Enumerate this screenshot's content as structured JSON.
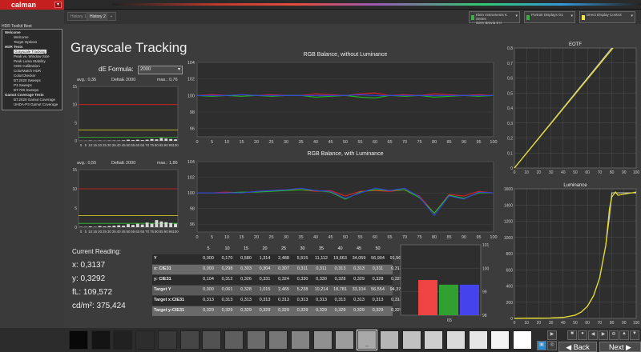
{
  "app": {
    "logo": "calman"
  },
  "tabs": [
    "History 1",
    "History 2"
  ],
  "devices": [
    {
      "line1": "Klein Instruments K Series",
      "line2": "Sony Bravia 8 II",
      "color": "#3cb043"
    },
    {
      "line1": "Portrait Displays G1",
      "line2": "",
      "color": "#3cb043"
    },
    {
      "line1": "Direct Display Control",
      "line2": "",
      "color": "#f1e34a"
    }
  ],
  "sidebar": {
    "title": "HDR Toolkit Best",
    "items": [
      {
        "label": "Welcome",
        "level": 0
      },
      {
        "label": "Welcome",
        "level": 1
      },
      {
        "label": "Target Options",
        "level": 1
      },
      {
        "label": "HDR Tests",
        "level": 0
      },
      {
        "label": "Grayscale Tracking",
        "level": 1,
        "selected": true
      },
      {
        "label": "Peak vs. Window Size",
        "level": 1
      },
      {
        "label": "Peak Luma Stability",
        "level": 1
      },
      {
        "label": "CMS Calibration",
        "level": 1
      },
      {
        "label": "ColorMatch HDR",
        "level": 1
      },
      {
        "label": "ColorChecker",
        "level": 1
      },
      {
        "label": "BT.2020 Sweeps",
        "level": 1
      },
      {
        "label": "P3 Sweeps",
        "level": 1
      },
      {
        "label": "BT.709 Sweeps",
        "level": 1
      },
      {
        "label": "Gamut Coverage Tests",
        "level": 0
      },
      {
        "label": "BT.2020 Gamut Coverage",
        "level": 1
      },
      {
        "label": "UHDA-P3 Gamut Coverage",
        "level": 1
      }
    ]
  },
  "main": {
    "title": "Grayscale Tracking",
    "de_formula_label": "dE Formula:",
    "de_formula_value": "2000",
    "de1": {
      "avg": "avg.: 0,35",
      "label": "DeltaE 2000",
      "max": "max.: 0,76"
    },
    "de2": {
      "avg": "avg.: 0,55",
      "label": "DeltaE 2000",
      "max": "max.: 1,86"
    }
  },
  "chart_data": [
    {
      "type": "bar",
      "title": "",
      "categories": [
        "0",
        "5",
        "10",
        "15",
        "20",
        "25",
        "30",
        "35",
        "40",
        "45",
        "50",
        "55",
        "60",
        "65",
        "70",
        "75",
        "80",
        "85",
        "90",
        "95",
        "100"
      ],
      "values": [
        0.05,
        0.05,
        0.1,
        0.05,
        0.1,
        0.05,
        0.1,
        0.1,
        0.1,
        0.15,
        0.3,
        0.2,
        0.3,
        0.2,
        0.3,
        0.5,
        0.4,
        0.76,
        0.6,
        0.5,
        0.4
      ],
      "ylim": [
        0,
        15
      ],
      "yticks": [
        "0",
        "5",
        "10",
        "15"
      ],
      "thresholds": [
        {
          "value": 10,
          "color": "#e02020"
        },
        {
          "value": 3,
          "color": "#e8e020"
        },
        {
          "value": 1,
          "color": "#30c030"
        }
      ]
    },
    {
      "type": "bar",
      "title": "",
      "categories": [
        "0",
        "5",
        "10",
        "15",
        "20",
        "25",
        "30",
        "35",
        "40",
        "45",
        "50",
        "55",
        "60",
        "65",
        "70",
        "75",
        "80",
        "85",
        "90",
        "95",
        "100"
      ],
      "values": [
        0.1,
        0.1,
        0.2,
        0.1,
        0.3,
        0.2,
        0.3,
        0.4,
        0.5,
        0.4,
        0.8,
        0.6,
        0.9,
        0.7,
        1.2,
        0.9,
        1.86,
        1.5,
        1.3,
        1.1,
        0.9
      ],
      "ylim": [
        0,
        15
      ],
      "yticks": [
        "0",
        "5",
        "10",
        "15"
      ],
      "thresholds": [
        {
          "value": 10,
          "color": "#e02020"
        },
        {
          "value": 3,
          "color": "#e8e020"
        },
        {
          "value": 1,
          "color": "#30c030"
        }
      ]
    },
    {
      "type": "line",
      "title": "RGB Balance, without Luminance",
      "x": [
        0,
        5,
        10,
        15,
        20,
        25,
        30,
        35,
        40,
        45,
        50,
        55,
        60,
        65,
        70,
        75,
        80,
        85,
        90,
        95,
        100
      ],
      "xticks": [
        "0",
        "5",
        "10",
        "15",
        "20",
        "25",
        "30",
        "35",
        "40",
        "45",
        "50",
        "55",
        "60",
        "65",
        "70",
        "75",
        "80",
        "85",
        "90",
        "95",
        "100"
      ],
      "ylim": [
        95,
        104
      ],
      "yticks": [
        "96",
        "98",
        "100",
        "102",
        "104"
      ],
      "series": [
        {
          "color": "#e02020",
          "values": [
            100,
            100.1,
            100,
            100.1,
            100,
            100.1,
            100,
            100,
            100.2,
            100.1,
            100,
            100.2,
            100.3,
            100,
            100.1,
            100,
            100.2,
            100.1,
            100,
            100.1,
            100
          ]
        },
        {
          "color": "#20c020",
          "values": [
            100,
            99.9,
            100,
            99.9,
            100,
            99.9,
            100,
            100,
            99.8,
            99.9,
            100,
            99.8,
            99.7,
            100,
            99.9,
            100,
            99.8,
            99.9,
            100,
            99.9,
            100
          ]
        },
        {
          "color": "#3040e0",
          "values": [
            100,
            100,
            100,
            100.1,
            100,
            100,
            100,
            100,
            100,
            100,
            100,
            100.1,
            100,
            100,
            100,
            100,
            100,
            100,
            100,
            100,
            100
          ]
        }
      ]
    },
    {
      "type": "line",
      "title": "RGB Balance, with Luminance",
      "x": [
        0,
        5,
        10,
        15,
        20,
        25,
        30,
        35,
        40,
        45,
        50,
        55,
        60,
        65,
        70,
        75,
        80,
        85,
        90,
        95,
        100
      ],
      "xticks": [
        "0",
        "5",
        "10",
        "15",
        "20",
        "25",
        "30",
        "35",
        "40",
        "45",
        "50",
        "55",
        "60",
        "65",
        "70",
        "75",
        "80",
        "85",
        "90",
        "95",
        "100"
      ],
      "ylim": [
        95,
        104
      ],
      "yticks": [
        "96",
        "98",
        "100",
        "102",
        "104"
      ],
      "series": [
        {
          "color": "#e02020",
          "values": [
            100,
            100,
            100.1,
            100,
            100.2,
            100.3,
            100.4,
            100.4,
            100.2,
            100.3,
            99.6,
            100.2,
            100.3,
            100.2,
            100.4,
            99.6,
            97.4,
            99.8,
            99.6,
            100.2,
            100
          ]
        },
        {
          "color": "#20c020",
          "values": [
            100,
            100,
            100,
            100.1,
            100.1,
            100.2,
            100.3,
            100.4,
            100.3,
            100.1,
            99.2,
            100.1,
            100.4,
            100.3,
            100.4,
            99.4,
            97.4,
            99.7,
            99.3,
            100,
            100
          ]
        },
        {
          "color": "#3040e0",
          "values": [
            100,
            100,
            100,
            100,
            100.2,
            100.3,
            100.4,
            100.6,
            100.3,
            100.2,
            99.3,
            100,
            100.6,
            100.3,
            100.6,
            99.5,
            97.1,
            99.6,
            99.2,
            100.1,
            100
          ]
        }
      ]
    },
    {
      "type": "line",
      "title": "EOTF",
      "xlim": [
        0,
        100
      ],
      "ylim": [
        0,
        0.8
      ],
      "xticks": [
        "0",
        "10",
        "20",
        "30",
        "40",
        "50",
        "60",
        "70",
        "80",
        "90",
        "100"
      ],
      "yticks": [
        "0",
        "0,1",
        "0,2",
        "0,3",
        "0,4",
        "0,5",
        "0,6",
        "0,7",
        "0,8"
      ],
      "series": [
        {
          "color": "#c8c8c8",
          "x": [
            0,
            80
          ],
          "y": [
            0,
            0.8
          ]
        },
        {
          "color": "#e8e020",
          "x": [
            0,
            80,
            81
          ],
          "y": [
            0,
            0.79,
            0.8
          ]
        }
      ]
    },
    {
      "type": "line",
      "title": "Luminance",
      "xlim": [
        0,
        100
      ],
      "ylim": [
        0,
        1600
      ],
      "xticks": [
        "0",
        "10",
        "20",
        "30",
        "40",
        "50",
        "60",
        "70",
        "80",
        "90",
        "100"
      ],
      "yticks": [
        "0",
        "200",
        "400",
        "600",
        "800",
        "1000",
        "1200",
        "1400",
        "1600"
      ],
      "series": [
        {
          "color": "#c8c8c8",
          "x": [
            0,
            30,
            40,
            50,
            55,
            60,
            65,
            70,
            75,
            78,
            80,
            100
          ],
          "y": [
            0,
            5,
            12,
            40,
            80,
            150,
            280,
            500,
            900,
            1250,
            1550,
            1550
          ]
        },
        {
          "color": "#e8e020",
          "x": [
            0,
            30,
            40,
            50,
            55,
            60,
            65,
            70,
            75,
            78,
            80,
            83,
            85,
            100
          ],
          "y": [
            0,
            5,
            12,
            40,
            80,
            150,
            280,
            500,
            900,
            1350,
            1500,
            1560,
            1520,
            1560
          ]
        }
      ]
    },
    {
      "type": "bar",
      "title": "",
      "categories": [
        "R",
        "G",
        "B"
      ],
      "colors": [
        "#ee4444",
        "#30a030",
        "#4444ee"
      ],
      "values": [
        99.5,
        99.3,
        99.3
      ],
      "ylim": [
        98,
        101
      ],
      "yticks": [
        "98",
        "99",
        "100",
        "101"
      ],
      "xlabel": "65"
    }
  ],
  "reading": {
    "title": "Current Reading:",
    "x": "x: 0,3137",
    "y": "y: 0,3292",
    "fl": "fL: 109,572",
    "cd": "cd/m²: 375,424"
  },
  "table": {
    "headers": [
      "",
      "5",
      "10",
      "15",
      "20",
      "25",
      "30",
      "35",
      "40",
      "45",
      "50"
    ],
    "rows": [
      [
        "Y",
        "0,000",
        "0,170",
        "0,580",
        "1,314",
        "2,488",
        "5,515",
        "11,112",
        "19,663",
        "34,059",
        "56,904",
        "91,563"
      ],
      [
        "x: CIE31",
        "0,000",
        "0,298",
        "0,303",
        "0,304",
        "0,307",
        "0,311",
        "0,311",
        "0,313",
        "0,313",
        "0,311",
        "0,313"
      ],
      [
        "y: CIE31",
        "0,104",
        "0,312",
        "0,326",
        "0,331",
        "0,324",
        "0,330",
        "0,330",
        "0,328",
        "0,329",
        "0,328",
        "0,329"
      ],
      [
        "Target Y",
        "0,000",
        "0,061",
        "0,328",
        "1,015",
        "2,465",
        "5,238",
        "10,214",
        "18,781",
        "33,104",
        "56,554",
        "94,378"
      ],
      [
        "Target x:CIE31",
        "0,313",
        "0,313",
        "0,313",
        "0,313",
        "0,313",
        "0,313",
        "0,313",
        "0,313",
        "0,313",
        "0,313",
        "0,313"
      ],
      [
        "Target y:CIE31",
        "0,329",
        "0,329",
        "0,329",
        "0,329",
        "0,329",
        "0,329",
        "0,329",
        "0,329",
        "0,329",
        "0,329",
        "0,329"
      ]
    ]
  },
  "patches": {
    "current_label": "65",
    "levels": [
      0,
      5,
      10,
      15,
      20,
      25,
      30,
      35,
      40,
      45,
      50,
      55,
      60,
      65,
      70,
      75,
      80,
      85,
      90,
      95,
      100
    ]
  },
  "nav": {
    "back": "Back",
    "next": "Next"
  }
}
